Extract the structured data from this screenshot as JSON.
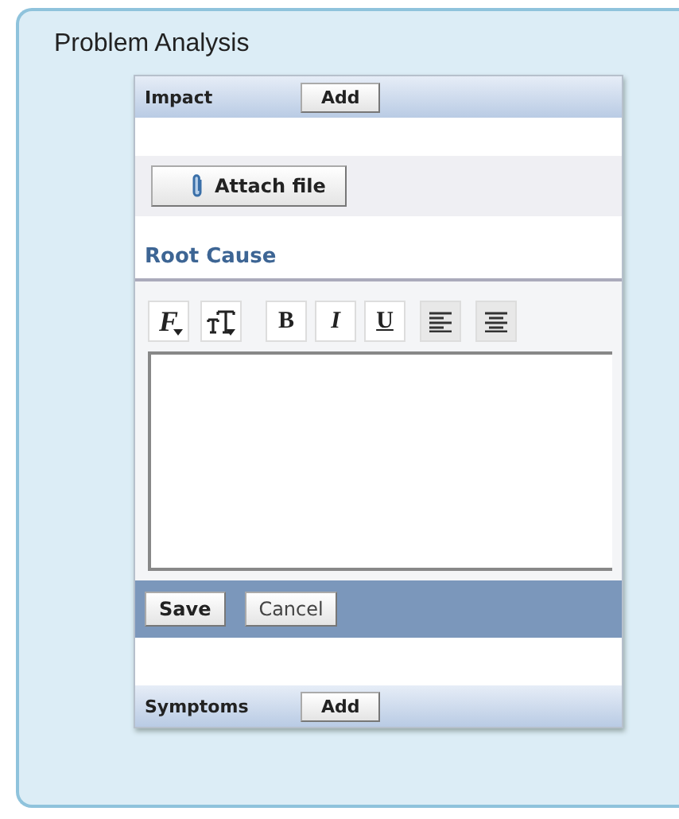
{
  "panel": {
    "title": "Problem Analysis"
  },
  "impact": {
    "label": "Impact",
    "add_button": "Add"
  },
  "attach_button": "Attach file",
  "root_cause": {
    "label": "Root Cause",
    "toolbar": [
      {
        "kind": "font",
        "label": "F"
      },
      {
        "kind": "size"
      },
      {
        "kind": "bold",
        "label": "B"
      },
      {
        "kind": "italic",
        "label": "I"
      },
      {
        "kind": "underline",
        "label": "U"
      },
      {
        "kind": "align-left"
      },
      {
        "kind": "align-center"
      }
    ],
    "buttons": [
      "Save",
      "Cancel"
    ]
  },
  "symptoms": {
    "label": "Symptoms",
    "add_button": "Add"
  }
}
